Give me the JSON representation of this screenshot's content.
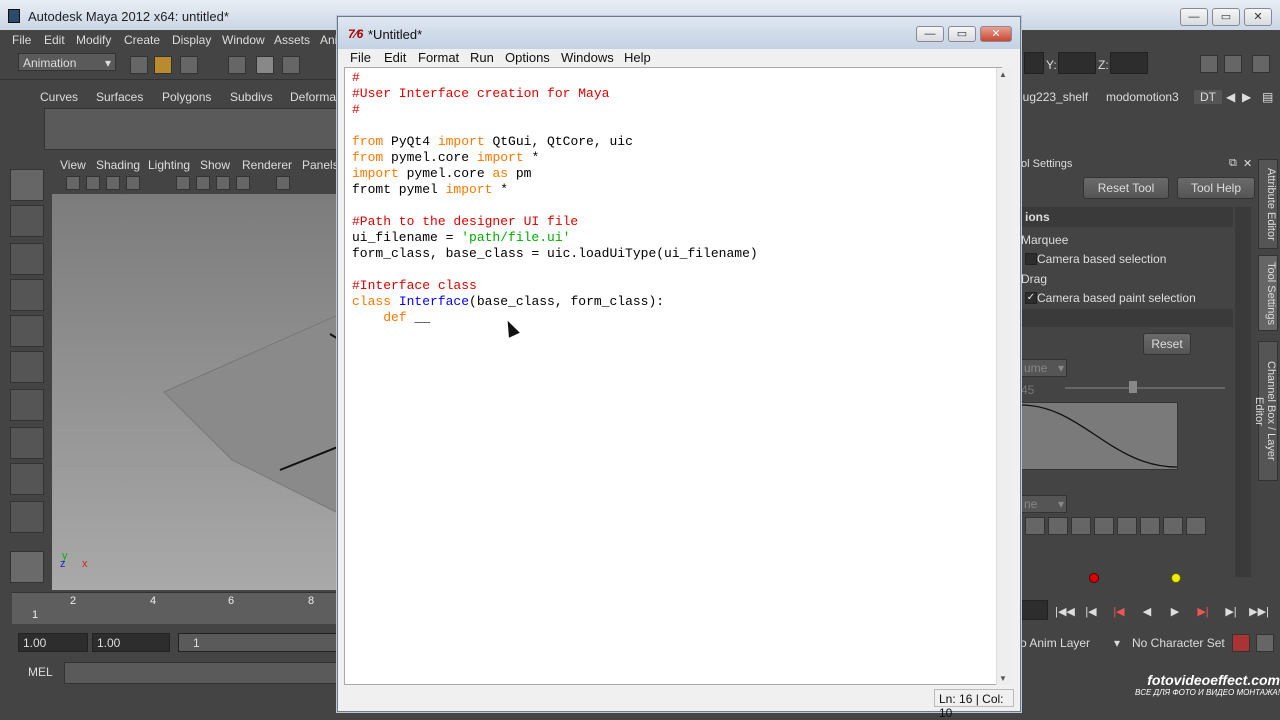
{
  "maya": {
    "title": "Autodesk Maya 2012 x64: untitled*",
    "menu": [
      "File",
      "Edit",
      "Modify",
      "Create",
      "Display",
      "Window",
      "Assets",
      "Ani"
    ],
    "mode": "Animation",
    "shelf_tabs": [
      "Curves",
      "Surfaces",
      "Polygons",
      "Subdivs",
      "Deformat"
    ],
    "viewport_menu": [
      "View",
      "Shading",
      "Lighting",
      "Show",
      "Renderer",
      "Panels"
    ],
    "timeline_ticks": [
      "1",
      "2",
      "4",
      "6",
      "8"
    ],
    "range_start": "1.00",
    "range_end": "1.00",
    "range_field": "1",
    "mel_label": "MEL",
    "coord_y_label": "Y:",
    "coord_z_label": "Z:",
    "right_shelf_tabs": [
      "jug223_shelf",
      "modomotion3",
      "DT"
    ],
    "tool_settings_header": "ol Settings",
    "reset_tool_label": "Reset Tool",
    "tool_help_label": "Tool Help",
    "section_options": "ions",
    "marquee_label": "Marquee",
    "camera_selection_label": "Camera based selection",
    "drag_label": "Drag",
    "camera_paint_label": "Camera based paint selection",
    "reset_label": "Reset",
    "dropdown_partial_1": "ume",
    "slider_partial": "45",
    "dropdown_partial_2": "ne",
    "side_tabs": [
      "Attribute Editor",
      "Tool Settings",
      "Channel Box / Layer Editor"
    ],
    "anim_layer_label": "o Anim Layer",
    "character_set_label": "No Character Set"
  },
  "editor": {
    "title": "*Untitled*",
    "icon_text": "7⁄6",
    "menu": [
      "File",
      "Edit",
      "Format",
      "Run",
      "Options",
      "Windows",
      "Help"
    ],
    "status": "Ln: 16 | Col: 10",
    "code_lines": [
      [
        [
          "cm",
          "#"
        ]
      ],
      [
        [
          "cm",
          "#User Interface creation for Maya"
        ]
      ],
      [
        [
          "cm",
          "#"
        ]
      ],
      [],
      [
        [
          "kw",
          "from"
        ],
        [
          "tx",
          " PyQt4 "
        ],
        [
          "kw",
          "import"
        ],
        [
          "tx",
          " QtGui, QtCore, uic"
        ]
      ],
      [
        [
          "kw",
          "from"
        ],
        [
          "tx",
          " pymel.core "
        ],
        [
          "kw",
          "import"
        ],
        [
          "tx",
          " *"
        ]
      ],
      [
        [
          "kw",
          "import"
        ],
        [
          "tx",
          " pymel.core "
        ],
        [
          "kw",
          "as"
        ],
        [
          "tx",
          " pm"
        ]
      ],
      [
        [
          "tx",
          "fromt pymel "
        ],
        [
          "kw",
          "import"
        ],
        [
          "tx",
          " *"
        ]
      ],
      [],
      [
        [
          "cm",
          "#Path to the designer UI file"
        ]
      ],
      [
        [
          "tx",
          "ui_filename = "
        ],
        [
          "st",
          "'path/file.ui'"
        ]
      ],
      [
        [
          "tx",
          "form_class, base_class = uic.loadUiType(ui_filename)"
        ]
      ],
      [],
      [
        [
          "cm",
          "#Interface class"
        ]
      ],
      [
        [
          "kw",
          "class"
        ],
        [
          "tx",
          " "
        ],
        [
          "df",
          "Interface"
        ],
        [
          "tx",
          "(base_class, form_class):"
        ]
      ],
      [
        [
          "tx",
          "    "
        ],
        [
          "kw",
          "def"
        ],
        [
          "tx",
          " __"
        ]
      ]
    ]
  },
  "watermark": {
    "line1": "fotovideoeffect.com",
    "line2": "ВСЕ ДЛЯ ФОТО И ВИДЕО МОНТАЖА!"
  }
}
